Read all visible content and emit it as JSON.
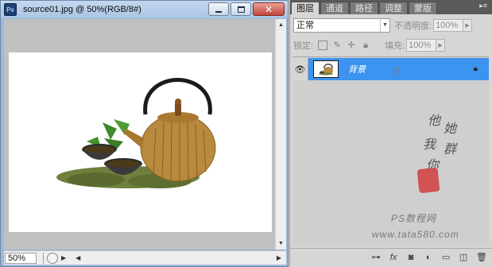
{
  "document_window": {
    "title": "source01.jpg @ 50%(RGB/8#)",
    "app_icon_label": "Ps",
    "zoom": "50%"
  },
  "icons": {
    "app": "photoshop-app-icon",
    "minimize": "minimize-icon",
    "maximize": "maximize-icon",
    "close": "close-icon",
    "visibility": "eye-icon",
    "layer_lock": "lock-icon",
    "cursor": "hand-cursor-icon"
  },
  "layers_panel": {
    "tabs": [
      "图层",
      "通道",
      "路径",
      "调整",
      "蒙版"
    ],
    "active_tab": 0,
    "blend_mode": "正常",
    "opacity_label": "不透明度:",
    "opacity_value": "100%",
    "lock_label": "锁定:",
    "fill_label": "填充:",
    "fill_value": "100%",
    "layers": [
      {
        "name": "背景",
        "visible": true,
        "locked": true,
        "selected": true
      }
    ],
    "footer_buttons": [
      "link-layers",
      "fx",
      "add-mask",
      "adjustment-layer",
      "new-group",
      "new-layer",
      "delete-layer"
    ]
  },
  "watermark": {
    "line1": "PS数程网",
    "line2": "www.tata580.com"
  },
  "colors": {
    "selection": "#3d93f0",
    "titlebar": "#a9c4e3",
    "panel_tab_bar": "#5a5a5a"
  }
}
